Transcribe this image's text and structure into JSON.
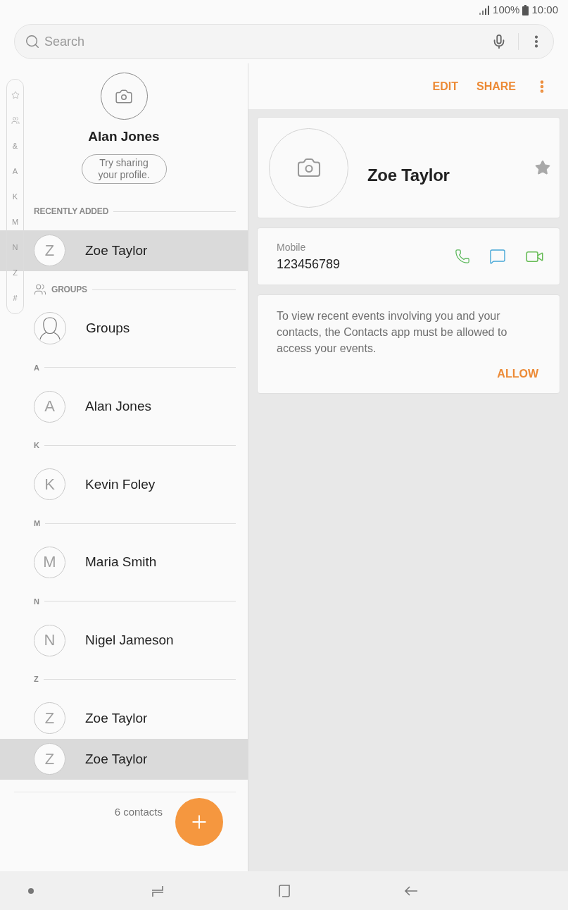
{
  "status_bar": {
    "battery": "100%",
    "time": "10:00"
  },
  "search": {
    "placeholder": "Search"
  },
  "index_bar": [
    {
      "kind": "favorites"
    },
    {
      "kind": "groups"
    },
    {
      "kind": "letter",
      "label": "&"
    },
    {
      "kind": "letter",
      "label": "A"
    },
    {
      "kind": "letter",
      "label": "K"
    },
    {
      "kind": "letter",
      "label": "M"
    },
    {
      "kind": "letter",
      "label": "N"
    },
    {
      "kind": "letter",
      "label": "Z"
    },
    {
      "kind": "letter",
      "label": "#"
    }
  ],
  "profile": {
    "name": "Alan Jones",
    "share_button": "Try sharing your profile."
  },
  "contact_list": {
    "sections": [
      {
        "kind": "recent",
        "title": "RECENTLY ADDED",
        "rows": [
          {
            "kind": "contact",
            "initial": "Z",
            "name": "Zoe Taylor",
            "selected": true
          }
        ]
      },
      {
        "kind": "groups",
        "title": "GROUPS",
        "rows": [
          {
            "kind": "group",
            "name": "Groups",
            "selected": false
          }
        ]
      },
      {
        "kind": "letter",
        "title": "A",
        "rows": [
          {
            "kind": "contact",
            "initial": "A",
            "name": "Alan Jones",
            "selected": false
          }
        ]
      },
      {
        "kind": "letter",
        "title": "K",
        "rows": [
          {
            "kind": "contact",
            "initial": "K",
            "name": "Kevin Foley",
            "selected": false
          }
        ]
      },
      {
        "kind": "letter",
        "title": "M",
        "rows": [
          {
            "kind": "contact",
            "initial": "M",
            "name": "Maria Smith",
            "selected": false
          }
        ]
      },
      {
        "kind": "letter",
        "title": "N",
        "rows": [
          {
            "kind": "contact",
            "initial": "N",
            "name": "Nigel Jameson",
            "selected": false
          }
        ]
      },
      {
        "kind": "letter",
        "title": "Z",
        "rows": [
          {
            "kind": "contact",
            "initial": "Z",
            "name": "Zoe Taylor",
            "selected": false
          },
          {
            "kind": "contact",
            "initial": "Z",
            "name": "Zoe Taylor",
            "selected": true
          }
        ]
      }
    ]
  },
  "footer": {
    "count": "6 contacts"
  },
  "detail": {
    "actions": [
      "EDIT",
      "SHARE"
    ],
    "name": "Zoe Taylor",
    "favorite": false,
    "phone": {
      "label": "Mobile",
      "number": "123456789"
    },
    "events_notice": {
      "text": "To view recent events involving you and your contacts, the Contacts app must be allowed to access your events.",
      "action": "ALLOW"
    }
  }
}
